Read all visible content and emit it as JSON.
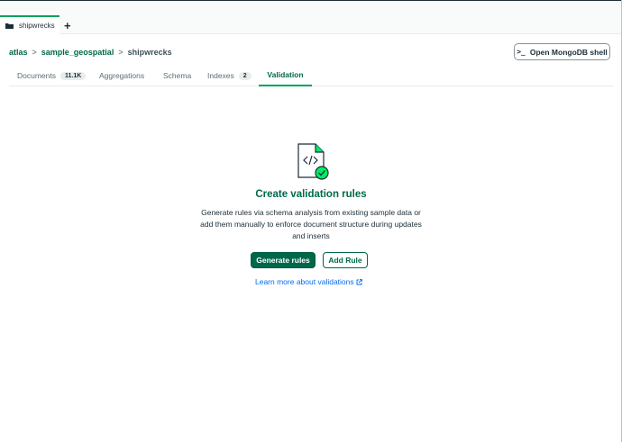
{
  "connection_tab": {
    "label": "shipwrecks",
    "icon": "folder-icon"
  },
  "add_tab": {
    "label": "+"
  },
  "breadcrumb": {
    "items": [
      "atlas",
      "sample_geospatial"
    ],
    "current": "shipwrecks",
    "separator": ">"
  },
  "shell_button": {
    "glyph": ">_",
    "label": "Open MongoDB shell"
  },
  "tabs": [
    {
      "label": "Documents",
      "badge": "11.1K"
    },
    {
      "label": "Aggregations"
    },
    {
      "label": "Schema"
    },
    {
      "label": "Indexes",
      "badge": "2"
    },
    {
      "label": "Validation",
      "active": true
    }
  ],
  "empty_state": {
    "icon": "validation-document-icon",
    "title": "Create validation rules",
    "description": "Generate rules via schema analysis from existing sample data or add them manually to enforce document structure during updates and inserts",
    "primary_button": "Generate rules",
    "secondary_button": "Add Rule",
    "link": "Learn more about validations"
  },
  "colors": {
    "brand_green": "#00684a",
    "accent_green": "#00a35c",
    "link_blue": "#016bf8"
  }
}
